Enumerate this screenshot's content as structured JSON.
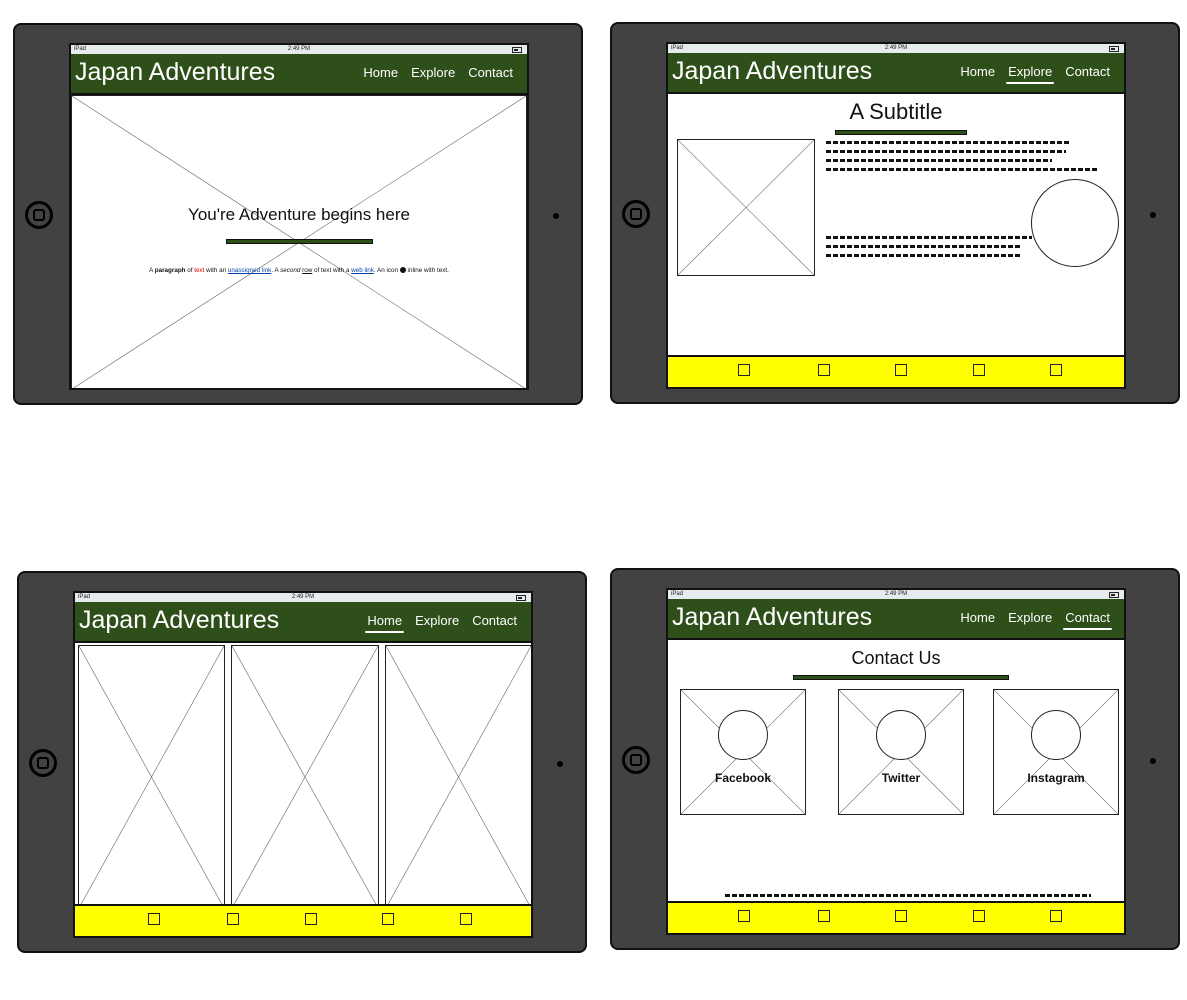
{
  "device": {
    "carrier": "iPad",
    "time": "2:49 PM"
  },
  "brand": "Japan Adventures",
  "nav": [
    "Home",
    "Explore",
    "Contact"
  ],
  "home_screen": {
    "heading": "You're Adventure begins here",
    "paragraph": {
      "p1": "A ",
      "bold": "paragraph",
      "p2": " of ",
      "red": "text",
      "p3": " with an ",
      "link1": "unassigned link",
      "p4": ". A ",
      "italic": "second",
      "p5": " ",
      "underline": "row",
      "p6": " of text with a ",
      "link2": "web link",
      "p7": ". An icon ",
      "p8": " inline with text."
    }
  },
  "explore_screen": {
    "subtitle": "A Subtitle"
  },
  "contact_screen": {
    "title": "Contact Us",
    "cards": [
      {
        "label": "Facebook"
      },
      {
        "label": "Twitter"
      },
      {
        "label": "Instagram"
      }
    ]
  },
  "colors": {
    "nav_bg": "#2e4f1a",
    "footer_bg": "#ffff00",
    "frame": "#424242"
  }
}
